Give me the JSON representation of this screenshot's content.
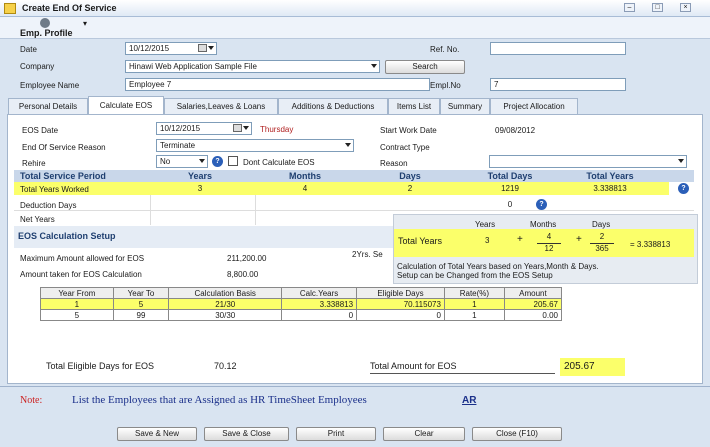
{
  "window": {
    "title": "Create End Of Service"
  },
  "toolbar": {
    "emp_profile": "Emp. Profile"
  },
  "form": {
    "date_label": "Date",
    "date_value": "10/12/2015",
    "ref_label": "Ref. No.",
    "ref_value": "",
    "company_label": "Company",
    "company_value": "Hinawi Web Application Sample File",
    "search_label": "Search",
    "employee_label": "Employee Name",
    "employee_value": "Employee 7",
    "emplno_label": "Empl.No",
    "emplno_value": "7"
  },
  "tabs": [
    "Personal Details",
    "Calculate EOS",
    "Salaries,Leaves & Loans",
    "Additions & Deductions",
    "Items List",
    "Summary",
    "Project Allocation"
  ],
  "eos": {
    "eos_date_label": "EOS Date",
    "eos_date_value": "10/12/2015",
    "weekday": "Thursday",
    "start_work_label": "Start Work Date",
    "start_work_value": "09/08/2012",
    "reason_label": "End Of Service Reason",
    "reason_value": "Terminate",
    "contract_label": "Contract Type",
    "rehire_label": "Rehire",
    "rehire_value": "No",
    "dont_calc_label": "Dont Calculate EOS",
    "reason2_label": "Reason"
  },
  "service_grid": {
    "headers": [
      "Total Service Period",
      "Years",
      "Months",
      "Days",
      "Total Days",
      "Total Years"
    ],
    "rows": [
      {
        "label": "Total Years Worked",
        "years": "3",
        "months": "4",
        "days": "2",
        "total_days": "1219",
        "total_years": "3.338813"
      },
      {
        "label": "Deduction Days",
        "total_days": "0"
      },
      {
        "label": "Net Years"
      }
    ]
  },
  "setup": {
    "title": "EOS Calculation Setup",
    "max_label": "Maximum Amount allowed for EOS",
    "max_value": "211,200.00",
    "taken_label": "Amount taken for EOS Calculation",
    "taken_value": "8,800.00",
    "yrs_partial": "2Yrs. Se"
  },
  "formula": {
    "h_years": "Years",
    "h_months": "Months",
    "h_days": "Days",
    "label": "Total Years",
    "years": "3",
    "months_num": "4",
    "months_den": "12",
    "days_num": "2",
    "days_den": "365",
    "plus": "+",
    "equals": "= 3.338813",
    "note1": "Calculation of Total Years based on Years,Month & Days.",
    "note2": "Setup can be Changed from the EOS Setup"
  },
  "eos_table": {
    "headers": [
      "Year From",
      "Year To",
      "Calculation Basis",
      "Calc.Years",
      "Eligible Days",
      "Rate(%)",
      "Amount"
    ],
    "rows": [
      [
        "1",
        "5",
        "21/30",
        "3.338813",
        "70.115073",
        "1",
        "205.67"
      ],
      [
        "5",
        "99",
        "30/30",
        "0",
        "0",
        "1",
        "0.00"
      ]
    ]
  },
  "totals": {
    "eligible_label": "Total Eligible Days for EOS",
    "eligible_value": "70.12",
    "amount_label": "Total Amount for EOS",
    "amount_value": "205.67"
  },
  "note": {
    "label": "Note:",
    "text": "List the Employees that are Assigned as HR  TimeSheet Employees",
    "link": "AR"
  },
  "buttons": {
    "save_new": "Save & New",
    "save_close": "Save & Close",
    "print": "Print",
    "clear": "Clear",
    "close": "Close (F10)"
  },
  "colors": {
    "highlight": "#fbff6a",
    "header_text": "#1f3f70",
    "weekday": "#b02020",
    "note_red": "#cc2222",
    "note_blue": "#1a2f8a"
  }
}
